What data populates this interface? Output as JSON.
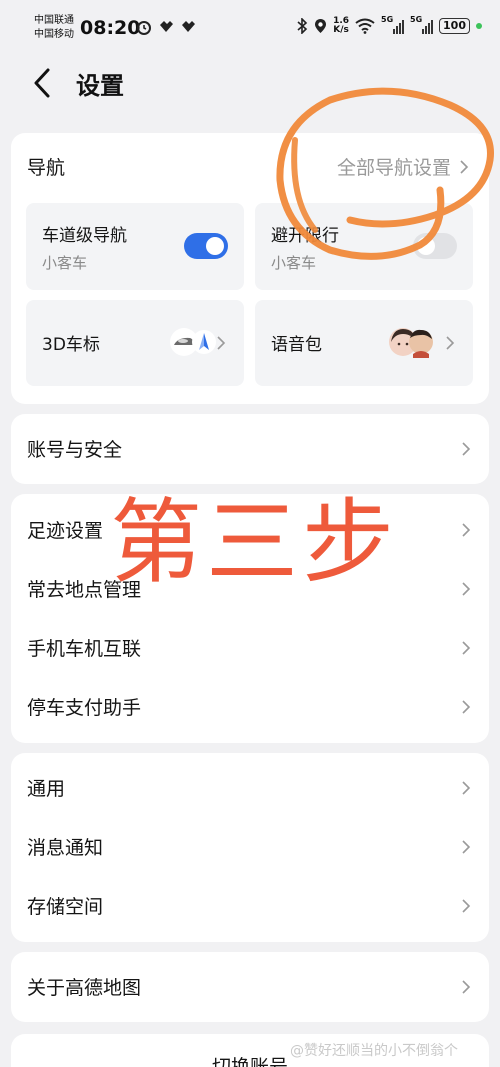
{
  "status_bar": {
    "carrier_1": "中国联通",
    "carrier_2": "中国移动",
    "time": "08:20",
    "speed_value": "1.6",
    "speed_unit": "K/s",
    "net_1": "5G",
    "net_2": "5G",
    "battery": "100"
  },
  "header": {
    "title": "设置"
  },
  "nav_card": {
    "title": "导航",
    "all_settings": "全部导航设置",
    "tiles": [
      {
        "title": "车道级导航",
        "subtitle": "小客车",
        "toggle_on": true
      },
      {
        "title": "避开限行",
        "subtitle": "小客车",
        "toggle_on": false
      },
      {
        "title": "3D车标"
      },
      {
        "title": "语音包"
      }
    ]
  },
  "account_card": {
    "item": "账号与安全"
  },
  "group_1": [
    "足迹设置",
    "常去地点管理",
    "手机车机互联",
    "停车支付助手"
  ],
  "group_2": [
    "通用",
    "消息通知",
    "存储空间"
  ],
  "about_card": {
    "item": "关于高德地图"
  },
  "switch_card": {
    "item": "切换账号"
  },
  "annotation": {
    "text": "第三步"
  },
  "watermark": "@赞好还顺当的小不倒翁个",
  "colors": {
    "accent": "#2f6fe7",
    "annotation": "#ee5a3b",
    "card": "#ffffff",
    "background": "#f1f1f3"
  }
}
